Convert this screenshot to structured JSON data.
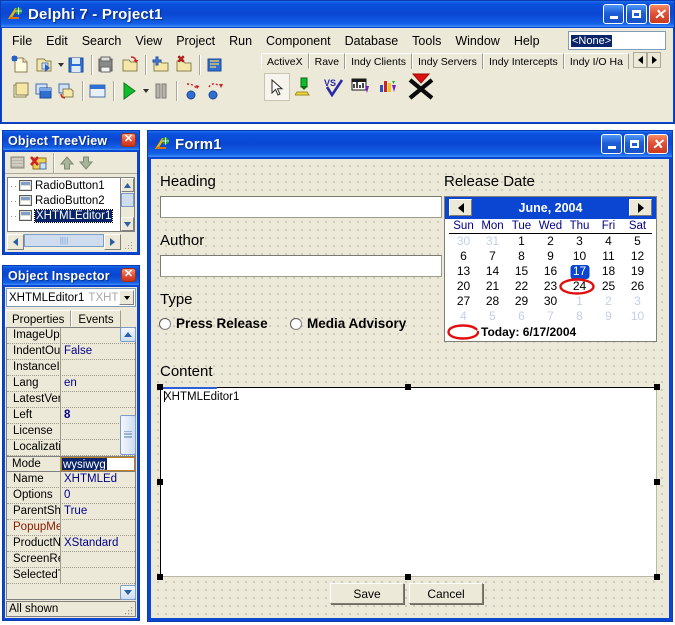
{
  "ide": {
    "title": "Delphi 7 - Project1",
    "window_buttons": {
      "minimize": "minimize-icon",
      "maximize": "maximize-icon",
      "close": "close-icon"
    },
    "menu": [
      "File",
      "Edit",
      "Search",
      "View",
      "Project",
      "Run",
      "Component",
      "Database",
      "Tools",
      "Window",
      "Help"
    ],
    "menu_combo_value": "<None>",
    "toolbar": {
      "row1": [
        "new-item-icon",
        "open-project-icon",
        "open-dropdown-arrow",
        "save-icon",
        "save-all-icon",
        "save-project-as-icon",
        "add-to-project-icon",
        "remove-from-project-icon",
        "help-book-icon"
      ],
      "row2": [
        "new-form-icon",
        "toggle-form-unit-icon",
        "view-unit-icon",
        "view-form-icon",
        "run-icon",
        "run-dropdown-arrow",
        "pause-icon",
        "trace-into-icon",
        "step-over-icon"
      ]
    },
    "palette": {
      "tabs": [
        "ActiveX",
        "Rave",
        "Indy Clients",
        "Indy Servers",
        "Indy Intercepts",
        "Indy I/O Ha"
      ],
      "active_tab": "ActiveX",
      "scroll_left": "scroll-left-arrow",
      "scroll_right": "scroll-right-arrow",
      "icons": [
        "pointer-tool-icon",
        "chartfx-icon",
        "vsspell-icon",
        "vtchart-icon",
        "f1book-icon",
        "xstandard-icon"
      ]
    }
  },
  "object_treeview": {
    "title": "Object TreeView",
    "close_label": "✕",
    "toolbar_icons": [
      "new-item-icon",
      "delete-item-icon",
      "move-up-icon",
      "move-down-icon"
    ],
    "items": [
      {
        "label": "RadioButton1",
        "selected": false
      },
      {
        "label": "RadioButton2",
        "selected": false
      },
      {
        "label": "XHTMLEditor1",
        "selected": true
      }
    ]
  },
  "object_inspector": {
    "title": "Object Inspector",
    "close_label": "✕",
    "selected_object": "XHTMLEditor1",
    "selected_class": "TXHTM",
    "tabs": [
      "Properties",
      "Events"
    ],
    "active_tab": "Properties",
    "properties": [
      {
        "name": "ImageUpl",
        "value": "",
        "kind": "normal"
      },
      {
        "name": "IndentOu",
        "value": "False",
        "kind": "normal"
      },
      {
        "name": "InstanceI",
        "value": "",
        "kind": "normal"
      },
      {
        "name": "Lang",
        "value": "en",
        "kind": "normal"
      },
      {
        "name": "LatestVer",
        "value": "",
        "kind": "normal"
      },
      {
        "name": "Left",
        "value": "8",
        "kind": "bold"
      },
      {
        "name": "License",
        "value": "",
        "kind": "normal"
      },
      {
        "name": "Localizati",
        "value": "",
        "kind": "normal"
      },
      {
        "name": "Mode",
        "value": "wysiwyg",
        "kind": "editing"
      },
      {
        "name": "Name",
        "value": "XHTMLEd",
        "kind": "normal"
      },
      {
        "name": "Options",
        "value": "0",
        "kind": "normal"
      },
      {
        "name": "ParentSh",
        "value": "True",
        "kind": "normal"
      },
      {
        "name": "PopupMe",
        "value": "",
        "kind": "event"
      },
      {
        "name": "ProductN",
        "value": "XStandard",
        "kind": "normal"
      },
      {
        "name": "ScreenRe",
        "value": "",
        "kind": "normal"
      },
      {
        "name": "SelectedT",
        "value": "",
        "kind": "normal"
      }
    ],
    "status": "All shown"
  },
  "form": {
    "title": "Form1",
    "window_buttons": {
      "minimize": "minimize-icon",
      "maximize": "maximize-icon",
      "close": "close-icon"
    },
    "labels": {
      "heading": "Heading",
      "author": "Author",
      "type": "Type",
      "content": "Content",
      "release_date": "Release Date"
    },
    "fields": {
      "heading_value": "",
      "author_value": ""
    },
    "radios": [
      {
        "label": "Press Release",
        "checked": false
      },
      {
        "label": "Media Advisory",
        "checked": false
      }
    ],
    "editor": {
      "component_name": "XHTMLEditor1",
      "selected": true
    },
    "buttons": [
      {
        "label": "Save"
      },
      {
        "label": "Cancel"
      }
    ]
  },
  "calendar": {
    "month_year": "June, 2004",
    "prev_label": "prev-month-arrow",
    "next_label": "next-month-arrow",
    "day_headers": [
      "Sun",
      "Mon",
      "Tue",
      "Wed",
      "Thu",
      "Fri",
      "Sat"
    ],
    "weeks": [
      [
        {
          "d": "30",
          "dim": true
        },
        {
          "d": "31",
          "dim": true
        },
        {
          "d": "1"
        },
        {
          "d": "2"
        },
        {
          "d": "3"
        },
        {
          "d": "4"
        },
        {
          "d": "5"
        }
      ],
      [
        {
          "d": "6"
        },
        {
          "d": "7"
        },
        {
          "d": "8"
        },
        {
          "d": "9"
        },
        {
          "d": "10"
        },
        {
          "d": "11"
        },
        {
          "d": "12"
        }
      ],
      [
        {
          "d": "13"
        },
        {
          "d": "14"
        },
        {
          "d": "15"
        },
        {
          "d": "16"
        },
        {
          "d": "17",
          "selected": true
        },
        {
          "d": "18"
        },
        {
          "d": "19"
        }
      ],
      [
        {
          "d": "20"
        },
        {
          "d": "21"
        },
        {
          "d": "22"
        },
        {
          "d": "23"
        },
        {
          "d": "24"
        },
        {
          "d": "25"
        },
        {
          "d": "26"
        }
      ],
      [
        {
          "d": "27"
        },
        {
          "d": "28"
        },
        {
          "d": "29"
        },
        {
          "d": "30"
        },
        {
          "d": "1",
          "dim": true
        },
        {
          "d": "2",
          "dim": true
        },
        {
          "d": "3",
          "dim": true
        }
      ],
      [
        {
          "d": "4",
          "dim": true
        },
        {
          "d": "5",
          "dim": true
        },
        {
          "d": "6",
          "dim": true
        },
        {
          "d": "7",
          "dim": true
        },
        {
          "d": "8",
          "dim": true
        },
        {
          "d": "9",
          "dim": true
        },
        {
          "d": "10",
          "dim": true
        }
      ]
    ],
    "today_text": "Today: 6/17/2004",
    "annotation_color": "#e01010"
  },
  "colors": {
    "titlebar_blue": "#0a46d2",
    "face": "#ece9d8",
    "selection_navy": "#0a246a",
    "property_value_blue": "#00008b",
    "event_red": "#8b1a00",
    "ink_red": "#e01010"
  }
}
